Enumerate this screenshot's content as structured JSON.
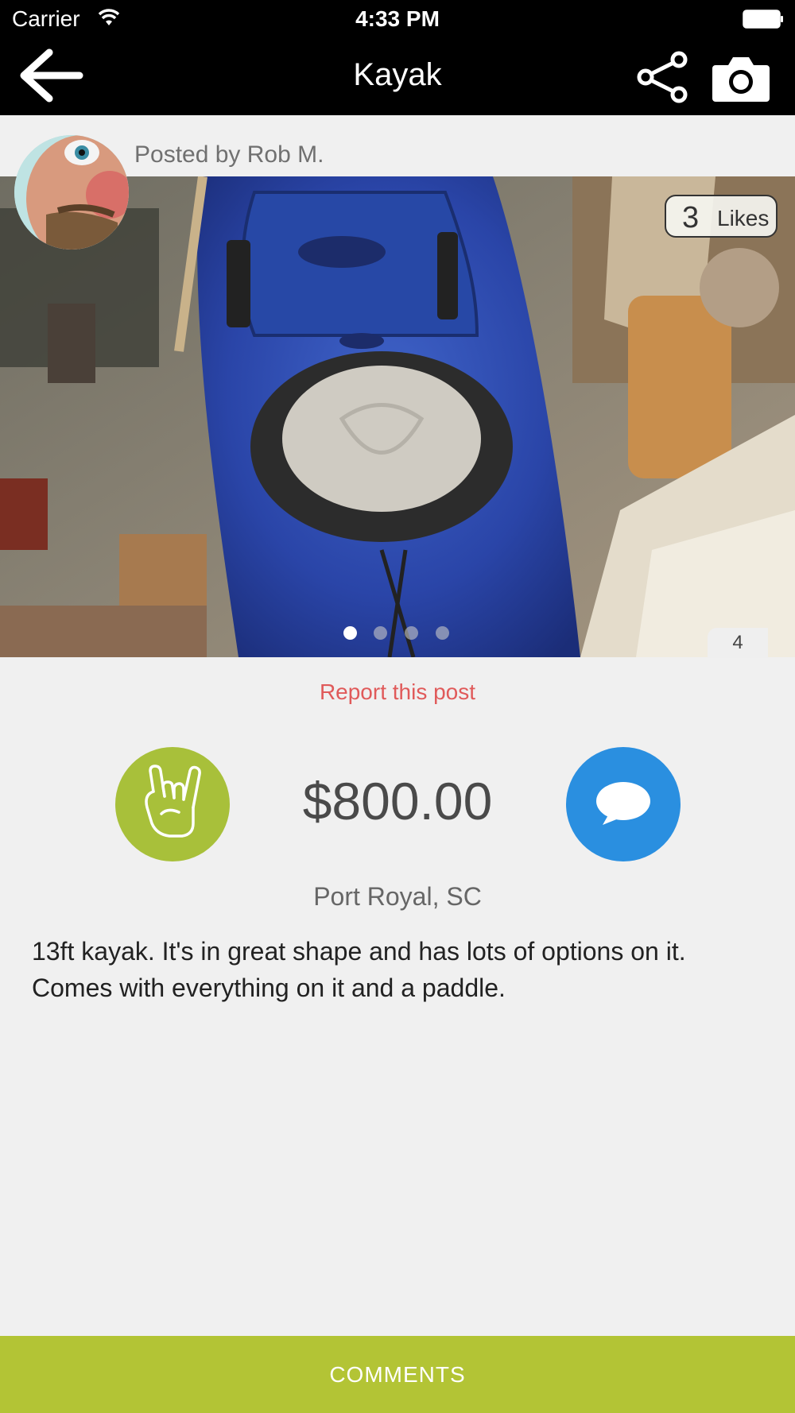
{
  "status_bar": {
    "carrier": "Carrier",
    "time": "4:33 PM"
  },
  "nav": {
    "title": "Kayak",
    "back_icon": "arrow-left-icon",
    "share_icon": "share-icon",
    "camera_icon": "camera-icon"
  },
  "post": {
    "posted_by": "Posted by Rob M.",
    "likes_count": "3",
    "likes_label": "Likes",
    "photo_count": "4",
    "photo_pages": 4,
    "active_photo_page": 1,
    "report_label": "Report this post",
    "price": "$800.00",
    "location": "Port Royal, SC",
    "description": "13ft kayak. It's in great shape and has lots of options on it. Comes with everything on it and a paddle."
  },
  "actions": {
    "rock_icon": "rock-hand-icon",
    "message_icon": "chat-bubble-icon"
  },
  "footer": {
    "comments_label": "COMMENTS"
  },
  "colors": {
    "accent_green": "#b3c435",
    "message_blue": "#2a8fe0",
    "report_red": "#e05a5a"
  }
}
